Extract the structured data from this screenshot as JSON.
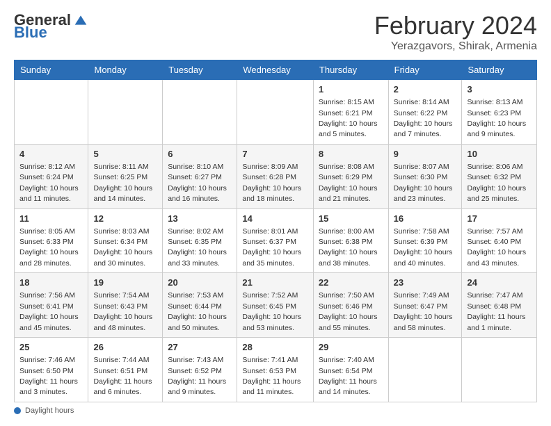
{
  "header": {
    "logo_general": "General",
    "logo_blue": "Blue",
    "month_title": "February 2024",
    "subtitle": "Yerazgavors, Shirak, Armenia"
  },
  "days_of_week": [
    "Sunday",
    "Monday",
    "Tuesday",
    "Wednesday",
    "Thursday",
    "Friday",
    "Saturday"
  ],
  "weeks": [
    [
      {
        "day": "",
        "info": ""
      },
      {
        "day": "",
        "info": ""
      },
      {
        "day": "",
        "info": ""
      },
      {
        "day": "",
        "info": ""
      },
      {
        "day": "1",
        "info": "Sunrise: 8:15 AM\nSunset: 6:21 PM\nDaylight: 10 hours\nand 5 minutes."
      },
      {
        "day": "2",
        "info": "Sunrise: 8:14 AM\nSunset: 6:22 PM\nDaylight: 10 hours\nand 7 minutes."
      },
      {
        "day": "3",
        "info": "Sunrise: 8:13 AM\nSunset: 6:23 PM\nDaylight: 10 hours\nand 9 minutes."
      }
    ],
    [
      {
        "day": "4",
        "info": "Sunrise: 8:12 AM\nSunset: 6:24 PM\nDaylight: 10 hours\nand 11 minutes."
      },
      {
        "day": "5",
        "info": "Sunrise: 8:11 AM\nSunset: 6:25 PM\nDaylight: 10 hours\nand 14 minutes."
      },
      {
        "day": "6",
        "info": "Sunrise: 8:10 AM\nSunset: 6:27 PM\nDaylight: 10 hours\nand 16 minutes."
      },
      {
        "day": "7",
        "info": "Sunrise: 8:09 AM\nSunset: 6:28 PM\nDaylight: 10 hours\nand 18 minutes."
      },
      {
        "day": "8",
        "info": "Sunrise: 8:08 AM\nSunset: 6:29 PM\nDaylight: 10 hours\nand 21 minutes."
      },
      {
        "day": "9",
        "info": "Sunrise: 8:07 AM\nSunset: 6:30 PM\nDaylight: 10 hours\nand 23 minutes."
      },
      {
        "day": "10",
        "info": "Sunrise: 8:06 AM\nSunset: 6:32 PM\nDaylight: 10 hours\nand 25 minutes."
      }
    ],
    [
      {
        "day": "11",
        "info": "Sunrise: 8:05 AM\nSunset: 6:33 PM\nDaylight: 10 hours\nand 28 minutes."
      },
      {
        "day": "12",
        "info": "Sunrise: 8:03 AM\nSunset: 6:34 PM\nDaylight: 10 hours\nand 30 minutes."
      },
      {
        "day": "13",
        "info": "Sunrise: 8:02 AM\nSunset: 6:35 PM\nDaylight: 10 hours\nand 33 minutes."
      },
      {
        "day": "14",
        "info": "Sunrise: 8:01 AM\nSunset: 6:37 PM\nDaylight: 10 hours\nand 35 minutes."
      },
      {
        "day": "15",
        "info": "Sunrise: 8:00 AM\nSunset: 6:38 PM\nDaylight: 10 hours\nand 38 minutes."
      },
      {
        "day": "16",
        "info": "Sunrise: 7:58 AM\nSunset: 6:39 PM\nDaylight: 10 hours\nand 40 minutes."
      },
      {
        "day": "17",
        "info": "Sunrise: 7:57 AM\nSunset: 6:40 PM\nDaylight: 10 hours\nand 43 minutes."
      }
    ],
    [
      {
        "day": "18",
        "info": "Sunrise: 7:56 AM\nSunset: 6:41 PM\nDaylight: 10 hours\nand 45 minutes."
      },
      {
        "day": "19",
        "info": "Sunrise: 7:54 AM\nSunset: 6:43 PM\nDaylight: 10 hours\nand 48 minutes."
      },
      {
        "day": "20",
        "info": "Sunrise: 7:53 AM\nSunset: 6:44 PM\nDaylight: 10 hours\nand 50 minutes."
      },
      {
        "day": "21",
        "info": "Sunrise: 7:52 AM\nSunset: 6:45 PM\nDaylight: 10 hours\nand 53 minutes."
      },
      {
        "day": "22",
        "info": "Sunrise: 7:50 AM\nSunset: 6:46 PM\nDaylight: 10 hours\nand 55 minutes."
      },
      {
        "day": "23",
        "info": "Sunrise: 7:49 AM\nSunset: 6:47 PM\nDaylight: 10 hours\nand 58 minutes."
      },
      {
        "day": "24",
        "info": "Sunrise: 7:47 AM\nSunset: 6:48 PM\nDaylight: 11 hours\nand 1 minute."
      }
    ],
    [
      {
        "day": "25",
        "info": "Sunrise: 7:46 AM\nSunset: 6:50 PM\nDaylight: 11 hours\nand 3 minutes."
      },
      {
        "day": "26",
        "info": "Sunrise: 7:44 AM\nSunset: 6:51 PM\nDaylight: 11 hours\nand 6 minutes."
      },
      {
        "day": "27",
        "info": "Sunrise: 7:43 AM\nSunset: 6:52 PM\nDaylight: 11 hours\nand 9 minutes."
      },
      {
        "day": "28",
        "info": "Sunrise: 7:41 AM\nSunset: 6:53 PM\nDaylight: 11 hours\nand 11 minutes."
      },
      {
        "day": "29",
        "info": "Sunrise: 7:40 AM\nSunset: 6:54 PM\nDaylight: 11 hours\nand 14 minutes."
      },
      {
        "day": "",
        "info": ""
      },
      {
        "day": "",
        "info": ""
      }
    ]
  ],
  "footer": {
    "daylight_label": "Daylight hours"
  }
}
